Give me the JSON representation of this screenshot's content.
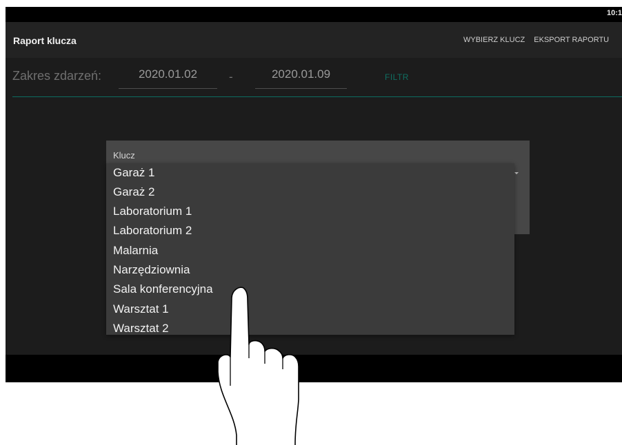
{
  "status": {
    "time": "10:1"
  },
  "appbar": {
    "title": "Raport klucza",
    "actions": [
      "WYBIERZ KLUCZ",
      "EKSPORT RAPORTU"
    ]
  },
  "filters": {
    "range_label": "Zakres zdarzeń:",
    "date_from": "2020.01.02",
    "separator": "-",
    "date_to": "2020.01.09",
    "filter_button": "FILTR"
  },
  "dialog": {
    "label": "Klucz",
    "options": [
      "Garaż 1",
      "Garaż 2",
      "Laboratorium 1",
      "Laboratorium 2",
      "Malarnia",
      "Narzędziownia",
      "Sala konferencyjna",
      "Warsztat 1",
      "Warsztat 2"
    ]
  },
  "colors": {
    "accent": "#0f6f62",
    "background": "#1c1c1c",
    "appbar": "#232323",
    "dropdown": "#3b3b3b"
  },
  "overlay": {
    "icon": "hand-pointer-icon"
  }
}
